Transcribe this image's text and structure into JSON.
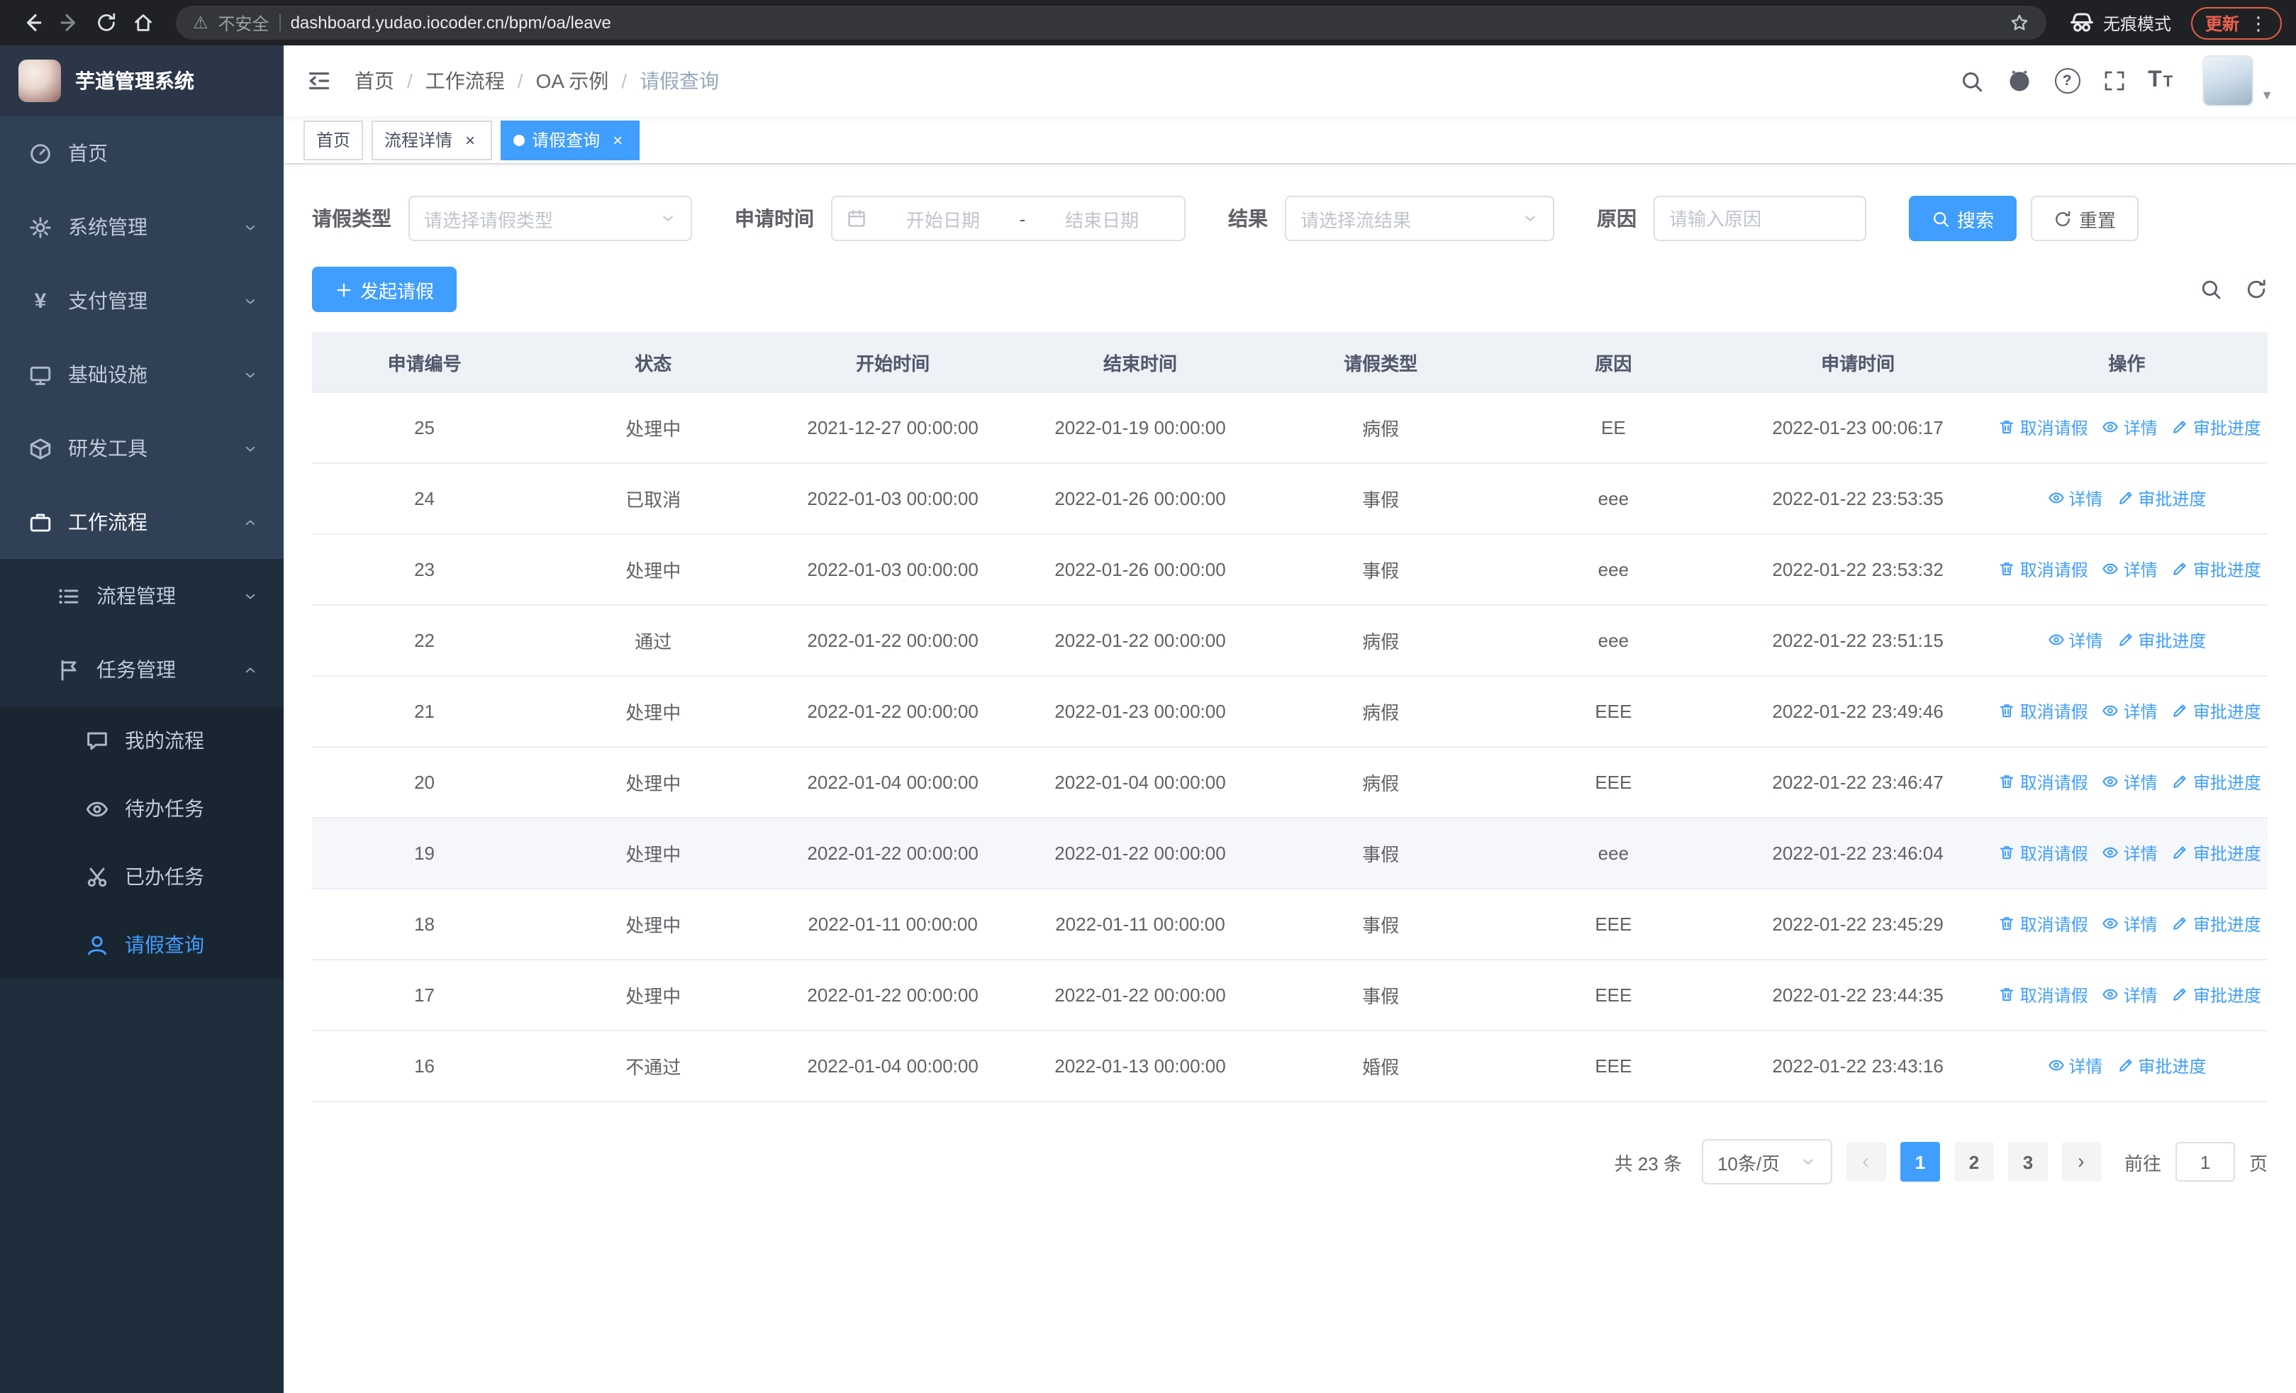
{
  "colors": {
    "accent": "#409eff",
    "sidebar_bg": "#304156",
    "sidebar_sub_bg": "#1f2d3d",
    "sidebar_text": "#bfcbd9",
    "table_header_bg": "#eef1f6",
    "chrome_bg": "#202124",
    "update_accent": "#e45d45"
  },
  "browser": {
    "security_label": "不安全",
    "url": "dashboard.yudao.iocoder.cn/bpm/oa/leave",
    "incognito_label": "无痕模式",
    "update_label": "更新",
    "icons": [
      "back-icon",
      "forward-icon",
      "reload-icon",
      "home-icon",
      "warning-icon",
      "bookmark-star-icon",
      "incognito-icon",
      "menu-dots-icon"
    ]
  },
  "sidebar": {
    "logo_title": "芋道管理系统",
    "items": [
      {
        "label": "首页",
        "icon": "dashboard-icon",
        "level": 1,
        "expandable": false,
        "expanded": false,
        "active": false
      },
      {
        "label": "系统管理",
        "icon": "gear-icon",
        "level": 1,
        "expandable": true,
        "expanded": false,
        "active": false
      },
      {
        "label": "支付管理",
        "icon": "yen-icon",
        "level": 1,
        "expandable": true,
        "expanded": false,
        "active": false
      },
      {
        "label": "基础设施",
        "icon": "monitor-icon",
        "level": 1,
        "expandable": true,
        "expanded": false,
        "active": false
      },
      {
        "label": "研发工具",
        "icon": "toolbox-icon",
        "level": 1,
        "expandable": true,
        "expanded": false,
        "active": false
      },
      {
        "label": "工作流程",
        "icon": "briefcase-icon",
        "level": 1,
        "expandable": true,
        "expanded": true,
        "active": false
      },
      {
        "label": "流程管理",
        "icon": "process-icon",
        "level": 2,
        "expandable": true,
        "expanded": false,
        "active": false
      },
      {
        "label": "任务管理",
        "icon": "task-icon",
        "level": 2,
        "expandable": true,
        "expanded": true,
        "active": false
      },
      {
        "label": "我的流程",
        "icon": "chat-icon",
        "level": 3,
        "expandable": false,
        "expanded": false,
        "active": false
      },
      {
        "label": "待办任务",
        "icon": "eye-icon",
        "level": 3,
        "expandable": false,
        "expanded": false,
        "active": false
      },
      {
        "label": "已办任务",
        "icon": "scissors-icon",
        "level": 3,
        "expandable": false,
        "expanded": false,
        "active": false
      },
      {
        "label": "请假查询",
        "icon": "user-icon",
        "level": 3,
        "expandable": false,
        "expanded": false,
        "active": true
      }
    ]
  },
  "navbar": {
    "breadcrumb": [
      "首页",
      "工作流程",
      "OA 示例",
      "请假查询"
    ],
    "icons": [
      "search-icon",
      "github-icon",
      "help-icon",
      "fullscreen-icon",
      "font-size-icon",
      "avatar",
      "chevron-down-icon"
    ]
  },
  "tabs": [
    {
      "label": "首页",
      "closable": false,
      "active": false
    },
    {
      "label": "流程详情",
      "closable": true,
      "active": false
    },
    {
      "label": "请假查询",
      "closable": true,
      "active": true
    }
  ],
  "filters": {
    "leave_type_label": "请假类型",
    "leave_type_placeholder": "请选择请假类型",
    "apply_time_label": "申请时间",
    "start_date_placeholder": "开始日期",
    "range_separator": "-",
    "end_date_placeholder": "结束日期",
    "result_label": "结果",
    "result_placeholder": "请选择流结果",
    "reason_label": "原因",
    "reason_placeholder": "请输入原因",
    "search_label": "搜索",
    "reset_label": "重置"
  },
  "toolbar": {
    "create_label": "发起请假"
  },
  "table": {
    "columns": [
      "申请编号",
      "状态",
      "开始时间",
      "结束时间",
      "请假类型",
      "原因",
      "申请时间",
      "操作"
    ],
    "action_labels": {
      "cancel": "取消请假",
      "detail": "详情",
      "progress": "审批进度"
    },
    "action_icons": {
      "cancel": "trash-icon",
      "detail": "eye-icon",
      "progress": "edit-icon"
    },
    "rows": [
      {
        "id": "25",
        "status": "处理中",
        "start": "2021-12-27 00:00:00",
        "end": "2022-01-19 00:00:00",
        "type": "病假",
        "reason": "EE",
        "applied": "2022-01-23 00:06:17",
        "actions": [
          "cancel",
          "detail",
          "progress"
        ],
        "highlight": false
      },
      {
        "id": "24",
        "status": "已取消",
        "start": "2022-01-03 00:00:00",
        "end": "2022-01-26 00:00:00",
        "type": "事假",
        "reason": "eee",
        "applied": "2022-01-22 23:53:35",
        "actions": [
          "detail",
          "progress"
        ],
        "highlight": false
      },
      {
        "id": "23",
        "status": "处理中",
        "start": "2022-01-03 00:00:00",
        "end": "2022-01-26 00:00:00",
        "type": "事假",
        "reason": "eee",
        "applied": "2022-01-22 23:53:32",
        "actions": [
          "cancel",
          "detail",
          "progress"
        ],
        "highlight": false
      },
      {
        "id": "22",
        "status": "通过",
        "start": "2022-01-22 00:00:00",
        "end": "2022-01-22 00:00:00",
        "type": "病假",
        "reason": "eee",
        "applied": "2022-01-22 23:51:15",
        "actions": [
          "detail",
          "progress"
        ],
        "highlight": false
      },
      {
        "id": "21",
        "status": "处理中",
        "start": "2022-01-22 00:00:00",
        "end": "2022-01-23 00:00:00",
        "type": "病假",
        "reason": "EEE",
        "applied": "2022-01-22 23:49:46",
        "actions": [
          "cancel",
          "detail",
          "progress"
        ],
        "highlight": false
      },
      {
        "id": "20",
        "status": "处理中",
        "start": "2022-01-04 00:00:00",
        "end": "2022-01-04 00:00:00",
        "type": "病假",
        "reason": "EEE",
        "applied": "2022-01-22 23:46:47",
        "actions": [
          "cancel",
          "detail",
          "progress"
        ],
        "highlight": false
      },
      {
        "id": "19",
        "status": "处理中",
        "start": "2022-01-22 00:00:00",
        "end": "2022-01-22 00:00:00",
        "type": "事假",
        "reason": "eee",
        "applied": "2022-01-22 23:46:04",
        "actions": [
          "cancel",
          "detail",
          "progress"
        ],
        "highlight": true
      },
      {
        "id": "18",
        "status": "处理中",
        "start": "2022-01-11 00:00:00",
        "end": "2022-01-11 00:00:00",
        "type": "事假",
        "reason": "EEE",
        "applied": "2022-01-22 23:45:29",
        "actions": [
          "cancel",
          "detail",
          "progress"
        ],
        "highlight": false
      },
      {
        "id": "17",
        "status": "处理中",
        "start": "2022-01-22 00:00:00",
        "end": "2022-01-22 00:00:00",
        "type": "事假",
        "reason": "EEE",
        "applied": "2022-01-22 23:44:35",
        "actions": [
          "cancel",
          "detail",
          "progress"
        ],
        "highlight": false
      },
      {
        "id": "16",
        "status": "不通过",
        "start": "2022-01-04 00:00:00",
        "end": "2022-01-13 00:00:00",
        "type": "婚假",
        "reason": "EEE",
        "applied": "2022-01-22 23:43:16",
        "actions": [
          "detail",
          "progress"
        ],
        "highlight": false
      }
    ]
  },
  "pagination": {
    "total_label": "共 23 条",
    "page_size": "10条/页",
    "pages": [
      "1",
      "2",
      "3"
    ],
    "active_page": "1",
    "goto_label": "前往",
    "goto_value": "1",
    "page_unit_label": "页"
  }
}
